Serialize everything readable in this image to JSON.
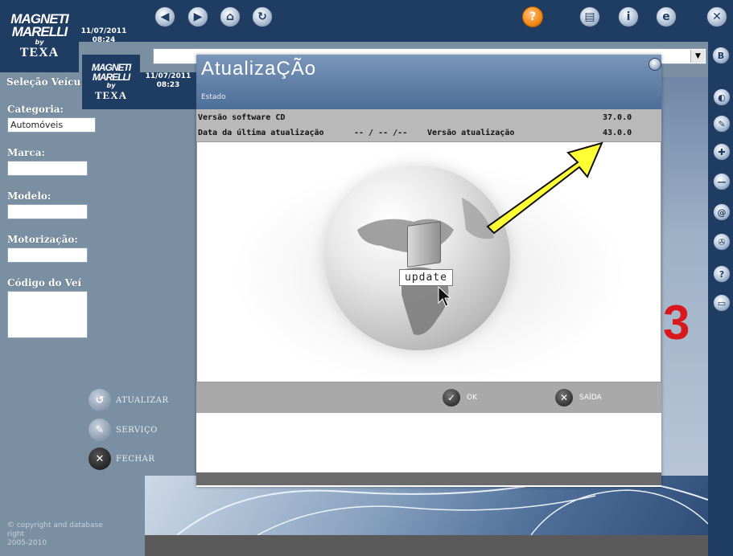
{
  "header": {
    "logo": {
      "magneti": "MAGNETI",
      "marelli": "MARELLI",
      "by": "by",
      "texa": "TEXA"
    },
    "date": "11/07/2011",
    "time": "08:24",
    "nav_icons": [
      "back-icon",
      "forward-icon",
      "home-icon",
      "refresh-icon"
    ],
    "right_icons": [
      "help-icon",
      "print-icon",
      "info-icon",
      "web-icon",
      "close-icon"
    ]
  },
  "sidebar": {
    "title": "Seleção Veícu",
    "fields": [
      {
        "label": "Categoria:",
        "value": "Automóveis"
      },
      {
        "label": "Marca:",
        "value": ""
      },
      {
        "label": "Modelo:",
        "value": ""
      },
      {
        "label": "Motorização:",
        "value": ""
      },
      {
        "label": "Código do Veí",
        "value": ""
      }
    ],
    "actions": [
      {
        "label": "ATUALIZAR",
        "icon": "update-icon"
      },
      {
        "label": "SERVIÇO",
        "icon": "service-icon"
      },
      {
        "label": "FECHAR",
        "icon": "close-icon"
      }
    ],
    "copyright": [
      "© copyright and database",
      "right",
      "2005-2010"
    ]
  },
  "dialog": {
    "logo_date": "11/07/2011",
    "logo_time": "08:23",
    "title": "AtualizaÇÃo",
    "subtitle": "Estado",
    "rows": {
      "software_label": "Versão software CD",
      "software_value": "37.0.0",
      "date_label": "Data da última atualização",
      "date_value": "-- / -- /--",
      "update_label": "Versão atualização",
      "update_value": "43.0.0"
    },
    "tooltip": "update",
    "ok_label": "OK",
    "exit_label": "SAÍDA"
  },
  "colors": {
    "navy": "#1f3d63",
    "slate": "#7b8fa3",
    "arrow": "#ffff33",
    "red": "#d8181a"
  }
}
